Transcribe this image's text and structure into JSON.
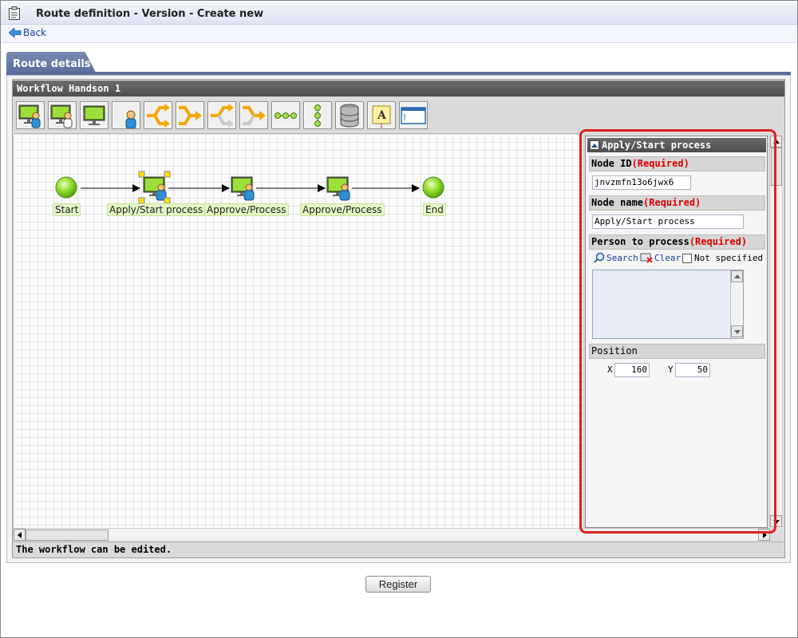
{
  "window": {
    "title": "Route definition - Version - Create new"
  },
  "nav": {
    "back_label": "Back"
  },
  "tab": {
    "label": "Route details"
  },
  "editor": {
    "workflow_name": "Workflow Handson 1",
    "toolbar_icons": [
      "apply-node-icon",
      "approve-node-icon",
      "monitor-node-icon",
      "person-node-icon",
      "branch-split-icon",
      "branch-merge-icon",
      "split-outline-icon",
      "merge-outline-icon",
      "horizontal-flow-icon",
      "vertical-flow-icon",
      "database-icon",
      "text-label-icon",
      "window-icon"
    ],
    "nodes": [
      {
        "label": "Start",
        "icon": "start-node-icon"
      },
      {
        "label": "Apply/Start process",
        "icon": "apply-node-icon"
      },
      {
        "label": "Approve/Process",
        "icon": "approve-node-icon"
      },
      {
        "label": "Approve/Process",
        "icon": "approve-node-icon"
      },
      {
        "label": "End",
        "icon": "end-node-icon"
      }
    ],
    "status": "The workflow can be edited."
  },
  "properties": {
    "title": "Apply/Start process",
    "node_id_label": "Node ID",
    "node_id_required": "(Required)",
    "node_id_value": "jnvzmfn13o6jwx6",
    "node_name_label": "Node name",
    "node_name_required": "(Required)",
    "node_name_value": "Apply/Start process",
    "person_label": "Person to process",
    "person_required": "(Required)",
    "search_label": "Search",
    "clear_label": "Clear",
    "not_specified_label": "Not specified",
    "position_label": "Position",
    "x_label": "X",
    "x_value": "160",
    "y_label": "Y",
    "y_value": "50"
  },
  "footer": {
    "register_label": "Register"
  },
  "colors": {
    "accent": "#5b6d9b",
    "required": "#e00000",
    "highlight": "#e02020",
    "node_label_bg": "#e5f6c6"
  }
}
